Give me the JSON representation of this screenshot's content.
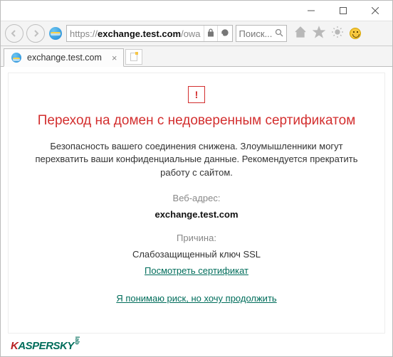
{
  "titlebar": {},
  "navbar": {
    "url_prefix": "https://",
    "url_bold": "exchange.test.com",
    "url_suffix": "/owa",
    "search_placeholder": "Поиск..."
  },
  "tab": {
    "title": "exchange.test.com"
  },
  "warning": {
    "icon_glyph": "!",
    "title": "Переход на домен с недоверенным сертификатом",
    "body": "Безопасность вашего соединения снижена. Злоумышленники могут перехватить ваши конфиденциальные данные. Рекомендуется прекратить работу с сайтом.",
    "web_address_label": "Веб-адрес:",
    "web_address_value": "exchange.test.com",
    "reason_label": "Причина:",
    "reason_value": "Слабозащищенный ключ SSL",
    "view_cert_link": "Посмотреть сертификат",
    "proceed_link": "Я понимаю риск, но хочу продолжить"
  },
  "footer": {
    "brand_k": "K",
    "brand_rest": "ASPERSKY",
    "brand_sup": "lab"
  }
}
